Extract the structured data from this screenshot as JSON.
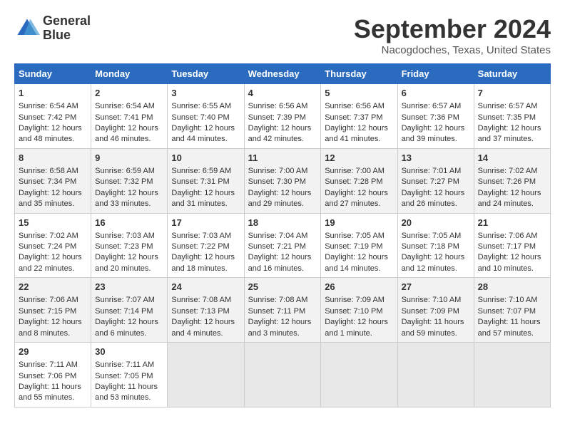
{
  "header": {
    "logo_line1": "General",
    "logo_line2": "Blue",
    "month_title": "September 2024",
    "location": "Nacogdoches, Texas, United States"
  },
  "weekdays": [
    "Sunday",
    "Monday",
    "Tuesday",
    "Wednesday",
    "Thursday",
    "Friday",
    "Saturday"
  ],
  "weeks": [
    [
      {
        "day": "1",
        "sunrise": "6:54 AM",
        "sunset": "7:42 PM",
        "daylight": "12 hours and 48 minutes."
      },
      {
        "day": "2",
        "sunrise": "6:54 AM",
        "sunset": "7:41 PM",
        "daylight": "12 hours and 46 minutes."
      },
      {
        "day": "3",
        "sunrise": "6:55 AM",
        "sunset": "7:40 PM",
        "daylight": "12 hours and 44 minutes."
      },
      {
        "day": "4",
        "sunrise": "6:56 AM",
        "sunset": "7:39 PM",
        "daylight": "12 hours and 42 minutes."
      },
      {
        "day": "5",
        "sunrise": "6:56 AM",
        "sunset": "7:37 PM",
        "daylight": "12 hours and 41 minutes."
      },
      {
        "day": "6",
        "sunrise": "6:57 AM",
        "sunset": "7:36 PM",
        "daylight": "12 hours and 39 minutes."
      },
      {
        "day": "7",
        "sunrise": "6:57 AM",
        "sunset": "7:35 PM",
        "daylight": "12 hours and 37 minutes."
      }
    ],
    [
      {
        "day": "8",
        "sunrise": "6:58 AM",
        "sunset": "7:34 PM",
        "daylight": "12 hours and 35 minutes."
      },
      {
        "day": "9",
        "sunrise": "6:59 AM",
        "sunset": "7:32 PM",
        "daylight": "12 hours and 33 minutes."
      },
      {
        "day": "10",
        "sunrise": "6:59 AM",
        "sunset": "7:31 PM",
        "daylight": "12 hours and 31 minutes."
      },
      {
        "day": "11",
        "sunrise": "7:00 AM",
        "sunset": "7:30 PM",
        "daylight": "12 hours and 29 minutes."
      },
      {
        "day": "12",
        "sunrise": "7:00 AM",
        "sunset": "7:28 PM",
        "daylight": "12 hours and 27 minutes."
      },
      {
        "day": "13",
        "sunrise": "7:01 AM",
        "sunset": "7:27 PM",
        "daylight": "12 hours and 26 minutes."
      },
      {
        "day": "14",
        "sunrise": "7:02 AM",
        "sunset": "7:26 PM",
        "daylight": "12 hours and 24 minutes."
      }
    ],
    [
      {
        "day": "15",
        "sunrise": "7:02 AM",
        "sunset": "7:24 PM",
        "daylight": "12 hours and 22 minutes."
      },
      {
        "day": "16",
        "sunrise": "7:03 AM",
        "sunset": "7:23 PM",
        "daylight": "12 hours and 20 minutes."
      },
      {
        "day": "17",
        "sunrise": "7:03 AM",
        "sunset": "7:22 PM",
        "daylight": "12 hours and 18 minutes."
      },
      {
        "day": "18",
        "sunrise": "7:04 AM",
        "sunset": "7:21 PM",
        "daylight": "12 hours and 16 minutes."
      },
      {
        "day": "19",
        "sunrise": "7:05 AM",
        "sunset": "7:19 PM",
        "daylight": "12 hours and 14 minutes."
      },
      {
        "day": "20",
        "sunrise": "7:05 AM",
        "sunset": "7:18 PM",
        "daylight": "12 hours and 12 minutes."
      },
      {
        "day": "21",
        "sunrise": "7:06 AM",
        "sunset": "7:17 PM",
        "daylight": "12 hours and 10 minutes."
      }
    ],
    [
      {
        "day": "22",
        "sunrise": "7:06 AM",
        "sunset": "7:15 PM",
        "daylight": "12 hours and 8 minutes."
      },
      {
        "day": "23",
        "sunrise": "7:07 AM",
        "sunset": "7:14 PM",
        "daylight": "12 hours and 6 minutes."
      },
      {
        "day": "24",
        "sunrise": "7:08 AM",
        "sunset": "7:13 PM",
        "daylight": "12 hours and 4 minutes."
      },
      {
        "day": "25",
        "sunrise": "7:08 AM",
        "sunset": "7:11 PM",
        "daylight": "12 hours and 3 minutes."
      },
      {
        "day": "26",
        "sunrise": "7:09 AM",
        "sunset": "7:10 PM",
        "daylight": "12 hours and 1 minute."
      },
      {
        "day": "27",
        "sunrise": "7:10 AM",
        "sunset": "7:09 PM",
        "daylight": "11 hours and 59 minutes."
      },
      {
        "day": "28",
        "sunrise": "7:10 AM",
        "sunset": "7:07 PM",
        "daylight": "11 hours and 57 minutes."
      }
    ],
    [
      {
        "day": "29",
        "sunrise": "7:11 AM",
        "sunset": "7:06 PM",
        "daylight": "11 hours and 55 minutes."
      },
      {
        "day": "30",
        "sunrise": "7:11 AM",
        "sunset": "7:05 PM",
        "daylight": "11 hours and 53 minutes."
      },
      null,
      null,
      null,
      null,
      null
    ]
  ]
}
